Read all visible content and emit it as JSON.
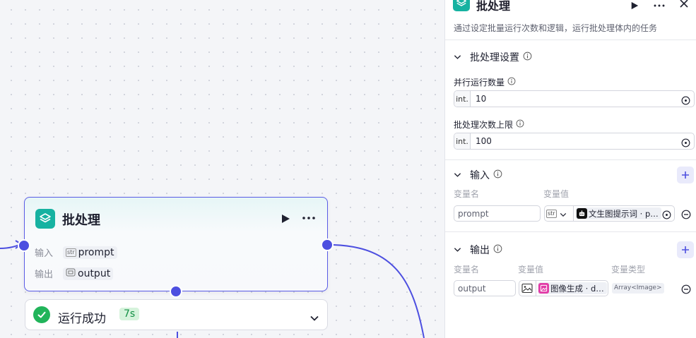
{
  "node": {
    "title": "批处理",
    "input_label": "输入",
    "input_type": "str",
    "input_value": "prompt",
    "output_label": "输出",
    "output_value": "output"
  },
  "status": {
    "text": "运行成功",
    "time": "7s"
  },
  "panel": {
    "title": "批处理",
    "description": "通过设定批量运行次数和逻辑，运行批处理体内的任务",
    "settings": {
      "heading": "批处理设置",
      "parallel_label": "并行运行数量",
      "parallel_prefix": "int.",
      "parallel_value": "10",
      "limit_label": "批处理次数上限",
      "limit_prefix": "int.",
      "limit_value": "100"
    },
    "inputs": {
      "heading": "输入",
      "col_name": "变量名",
      "col_value": "变量值",
      "var_name": "prompt",
      "type_tag": "str",
      "ref_text": "文生图提示词 · p…"
    },
    "outputs": {
      "heading": "输出",
      "col_name": "变量名",
      "col_value": "变量值",
      "col_type": "变量类型",
      "var_name": "output",
      "ref_text": "图像生成 · d…",
      "var_type": "Array<Image>"
    }
  },
  "colors": {
    "accent": "#4d4fe0",
    "node_icon": "#16b2a1",
    "success": "#21b45a",
    "image_gen_icon": "#e23da8"
  }
}
